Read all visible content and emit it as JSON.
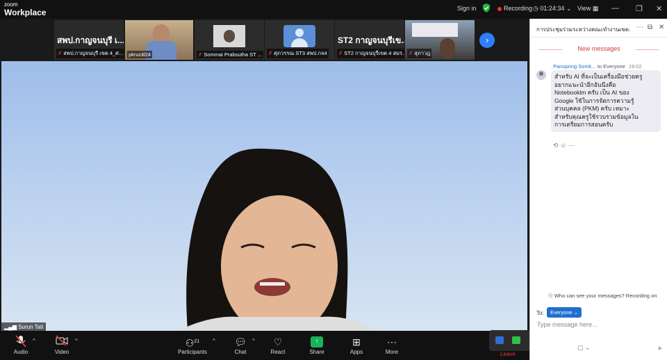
{
  "app": {
    "brand_line1": "zoom",
    "brand_line2": "Workplace"
  },
  "topbar": {
    "signin": "Sign in",
    "recording": "Recording",
    "clock": "01:24:34",
    "view": "View"
  },
  "strip": {
    "tiles": [
      {
        "big": "สพป.กาญจนบุรี เ...",
        "caption": "สพป.กาญจนบุรี เขต 4_ศ..."
      },
      {
        "big": "",
        "caption": "pkrucitl24"
      },
      {
        "big": "",
        "caption": "Sommai Prabsutha ST ..."
      },
      {
        "big": "",
        "caption": "ศุภวรรณ ST3 สพป.กจ4"
      },
      {
        "big": "ST2 กาญจนบุรีเข...",
        "caption": "ST2 กาญจนบุรีเขต 4 สมร..."
      },
      {
        "big": "",
        "caption": "สุภาวฎ"
      }
    ]
  },
  "main": {
    "speaker_name": "Surun Tati"
  },
  "toolbar": {
    "audio": "Audio",
    "video": "Video",
    "participants": "Participants",
    "participants_count": "21",
    "chat": "Chat",
    "react": "React",
    "share": "Share",
    "apps": "Apps",
    "more": "More",
    "leave": "Leave"
  },
  "chat": {
    "title": "การประชุมร่วมระหว่างคณะทำงานเขต...",
    "new_messages": "New messages",
    "message": {
      "sender": "Panupong Somk...",
      "to": "to Everyone",
      "time": "19:02",
      "lines": [
        "สำหรับ AI ที่จะเป็นเครื่องมือช่วยครู",
        "อยากแนะนำอีกอันนึงคือ",
        "Notebooklm ครับ เป็น AI ของ",
        "Google ใช้ในการจัดการความรู้",
        "ส่วนบุคคล (PKM) ครับ เหมาะ",
        "สำหรับคุณครูใช้รวบรวมข้อมูลใน",
        "การเตรียมการสอนครับ"
      ]
    },
    "who_can_see": "Who can see your messages? Recording on",
    "to_label": "To:",
    "recipient": "Everyone",
    "input_placeholder": "Type message here..."
  }
}
